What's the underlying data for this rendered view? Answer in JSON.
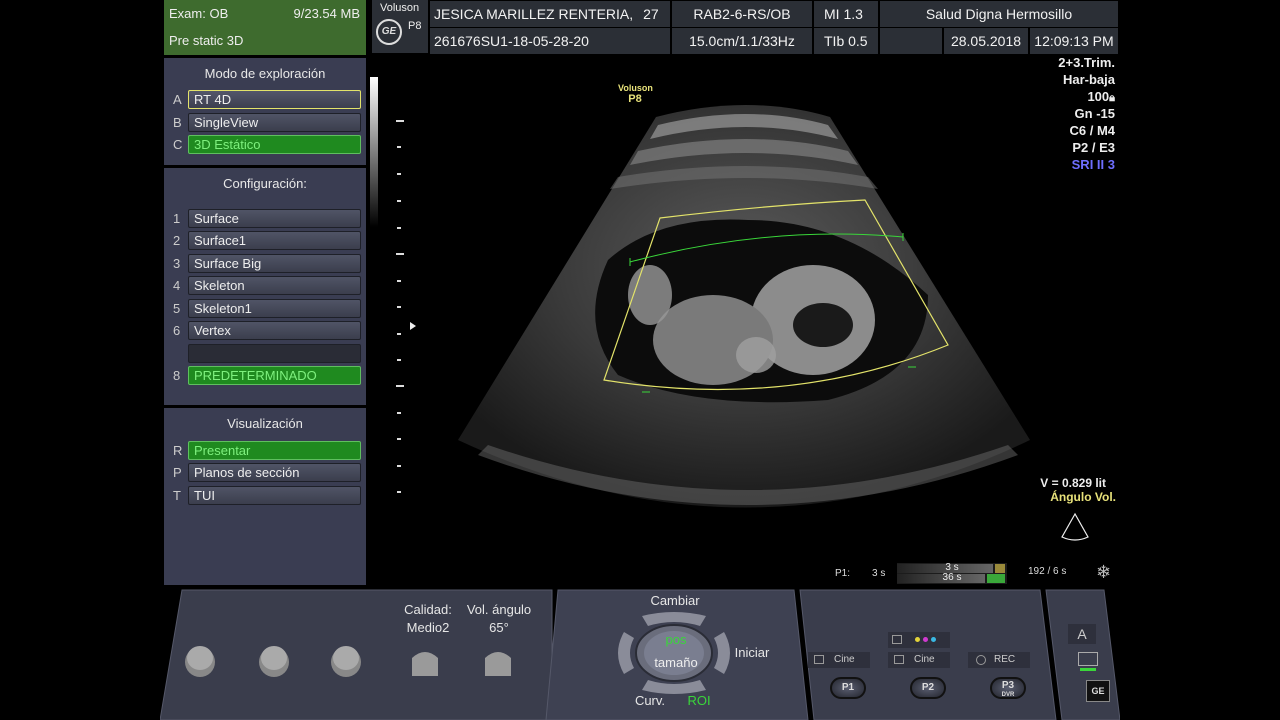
{
  "header": {
    "exam_label": "Exam: OB",
    "memory": "9/23.54 MB",
    "mode": "Pre static 3D",
    "brand": "Voluson",
    "brand_model": "P8",
    "brand_logo_text": "GE",
    "patient_name": "JESICA MARILLEZ RENTERIA,",
    "patient_age": "27",
    "probe": "RAB2-6-RS/OB",
    "mi": "MI  1.3",
    "institution": "Salud Digna Hermosillo",
    "patient_id": "261676SU1-18-05-28-20",
    "depth_freq": "15.0cm/1.1/33Hz",
    "tib": "TIb  0.5",
    "date": "28.05.2018",
    "time": "12:09:13 PM"
  },
  "left_panel": {
    "section1": {
      "title": "Modo de exploración",
      "items": [
        {
          "key": "A",
          "label": "RT 4D"
        },
        {
          "key": "B",
          "label": "SingleView"
        },
        {
          "key": "C",
          "label": "3D Estático"
        }
      ]
    },
    "section2": {
      "title": "Configuración:",
      "items": [
        {
          "key": "1",
          "label": "Surface"
        },
        {
          "key": "2",
          "label": "Surface1"
        },
        {
          "key": "3",
          "label": "Surface Big"
        },
        {
          "key": "4",
          "label": "Skeleton"
        },
        {
          "key": "5",
          "label": "Skeleton1"
        },
        {
          "key": "6",
          "label": "Vertex"
        },
        {
          "key": "",
          "label": ""
        },
        {
          "key": "8",
          "label": "PREDETERMINADO"
        }
      ]
    },
    "section3": {
      "title": "Visualización",
      "items": [
        {
          "key": "R",
          "label": "Presentar"
        },
        {
          "key": "P",
          "label": "Planos de sección"
        },
        {
          "key": "T",
          "label": "TUI"
        }
      ]
    }
  },
  "image_overlay": {
    "brand": "Voluson",
    "model": "P8",
    "params": [
      "2+3.Trim.",
      "Har-baja",
      "100",
      "Gn -15",
      "C6 / M4",
      "P2 / E3",
      "SRI II 3"
    ],
    "volume": "V = 0.829 lit",
    "angle_label": "Ángulo Vol.",
    "cine_p1": "P1:",
    "cine_time1": "3 s",
    "cine_bar_top": "3 s",
    "cine_bar_bottom": "36 s",
    "cine_frames": "192",
    "cine_frames_total": "6 s"
  },
  "console": {
    "quality_label": "Calidad:",
    "quality_value": "Medio2",
    "vol_angle_label": "Vol. ángulo",
    "vol_angle_value": "65°",
    "change": "Cambiar",
    "pos": "pos",
    "size": "tamaño",
    "start": "Iniciar",
    "curv": "Curv.",
    "roi": "ROI",
    "cine1": "Cine",
    "cine2": "Cine",
    "rec": "REC",
    "p1": "P1",
    "p2": "P2",
    "p3": "P3",
    "p3_sub": "DVR",
    "a_key": "A"
  },
  "colors": {
    "exam_bg": "#3e6b2e",
    "header_bg": "#2b2f36",
    "panel_bg": "#3a3d52",
    "active_green": "#1f8a1f",
    "roi_yellow": "#e3e36a",
    "sri_blue": "#6f6fff"
  }
}
